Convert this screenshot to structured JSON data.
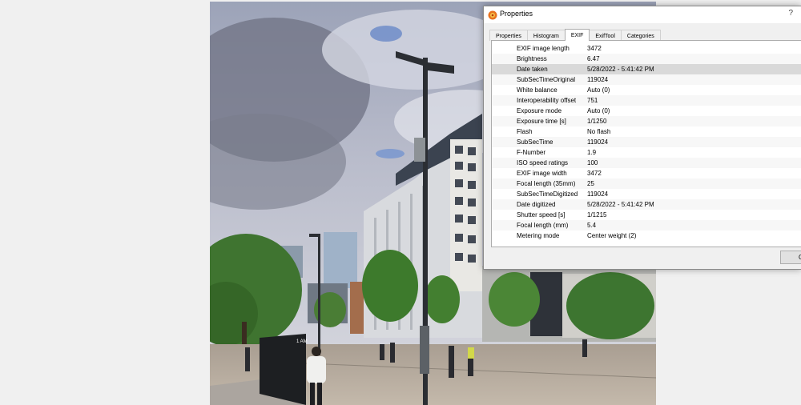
{
  "dialog": {
    "title": "Properties",
    "help": "?",
    "ok_label": "O"
  },
  "tabs": [
    {
      "label": "Properties"
    },
    {
      "label": "Histogram"
    },
    {
      "label": "EXIF"
    },
    {
      "label": "ExifTool"
    },
    {
      "label": "Categories"
    }
  ],
  "active_tab": "EXIF",
  "exif": [
    {
      "key": "EXIF image length",
      "value": "3472"
    },
    {
      "key": "Brightness",
      "value": "6.47"
    },
    {
      "key": "Date taken",
      "value": "5/28/2022 - 5:41:42 PM"
    },
    {
      "key": "SubSecTimeOriginal",
      "value": "119024"
    },
    {
      "key": "White balance",
      "value": "Auto (0)"
    },
    {
      "key": "Interoperability offset",
      "value": "751"
    },
    {
      "key": "Exposure mode",
      "value": "Auto (0)"
    },
    {
      "key": "Exposure time [s]",
      "value": "1/1250"
    },
    {
      "key": "Flash",
      "value": "No flash"
    },
    {
      "key": "SubSecTime",
      "value": "119024"
    },
    {
      "key": "F-Number",
      "value": "1.9"
    },
    {
      "key": "ISO speed ratings",
      "value": "100"
    },
    {
      "key": "EXIF image width",
      "value": "3472"
    },
    {
      "key": "Focal length (35mm)",
      "value": "25"
    },
    {
      "key": "SubSecTimeDigitized",
      "value": "119024"
    },
    {
      "key": "Date digitized",
      "value": "5/28/2022 - 5:41:42 PM"
    },
    {
      "key": "Shutter speed [s]",
      "value": "1/1215"
    },
    {
      "key": "Focal length (mm)",
      "value": "5.4"
    },
    {
      "key": "Metering mode",
      "value": "Center weight (2)"
    }
  ],
  "selected_row": 2,
  "photo": {
    "sign_text": "1 AM"
  },
  "colors": {
    "selection": "#d9d9d9",
    "sky": "#8a93a8",
    "pavement": "#b9ada0",
    "tree": "#3c6e2c"
  }
}
